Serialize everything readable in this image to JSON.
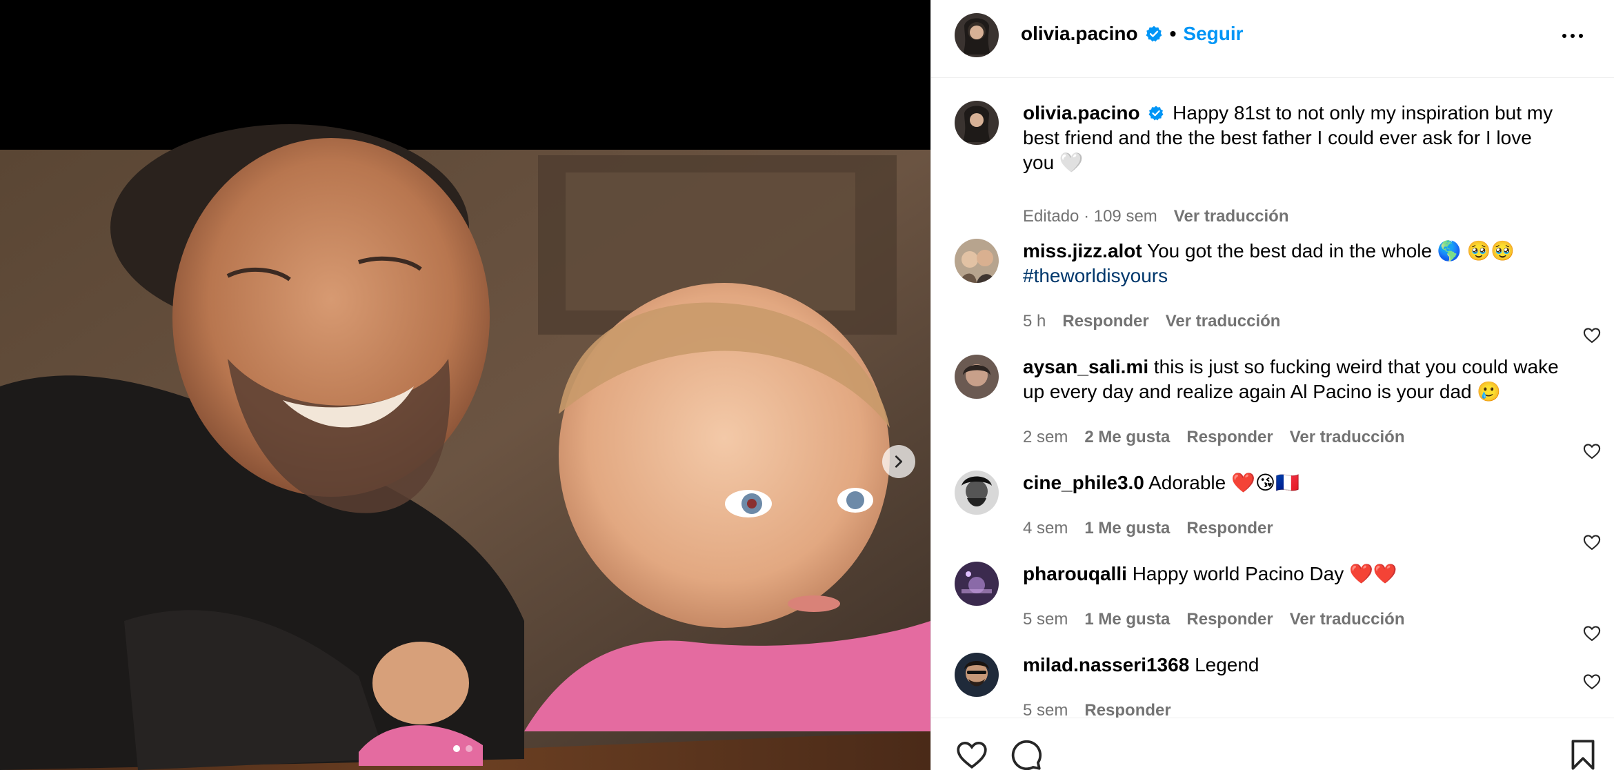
{
  "post": {
    "username": "olivia.pacino",
    "separator": "•",
    "follow_label": "Seguir",
    "carousel": {
      "slides": 2,
      "active_index": 0
    }
  },
  "caption": {
    "username": "olivia.pacino",
    "text": "Happy 81st to not only my inspiration but my best friend and the the best father I could ever ask for I love you 🤍",
    "meta_edited": "Editado · 109 sem",
    "translate": "Ver traducción"
  },
  "comments": [
    {
      "username": "miss.jizz.alot",
      "text": "You got the best dad in the whole 🌎 🥹🥹",
      "hashtag": "#theworldisyours",
      "time": "5 h",
      "reply": "Responder",
      "translate": "Ver traducción"
    },
    {
      "username": "aysan_sali.mi",
      "text": "this is just so fucking weird that you could wake up every day and realize again Al Pacino is your dad 🥲",
      "time": "2 sem",
      "likes": "2 Me gusta",
      "reply": "Responder",
      "translate": "Ver traducción"
    },
    {
      "username": "cine_phile3.0",
      "text": "Adorable ❤️😘🇫🇷",
      "time": "4 sem",
      "likes": "1 Me gusta",
      "reply": "Responder"
    },
    {
      "username": "pharouqalli",
      "text": "Happy world Pacino Day ❤️❤️",
      "time": "5 sem",
      "likes": "1 Me gusta",
      "reply": "Responder",
      "translate": "Ver traducción"
    },
    {
      "username": "milad.nasseri1368",
      "text": "Legend",
      "time": "5 sem",
      "reply": "Responder"
    }
  ],
  "colors": {
    "accent": "#0095f6",
    "hashtag": "#00376b",
    "secondary_text": "#737373",
    "verified": "#0095f6"
  },
  "icons": {
    "verified": "verified-badge-icon",
    "more": "more-options-icon",
    "next": "chevron-right-icon",
    "like": "heart-icon",
    "comment": "comment-icon",
    "save": "bookmark-icon"
  }
}
